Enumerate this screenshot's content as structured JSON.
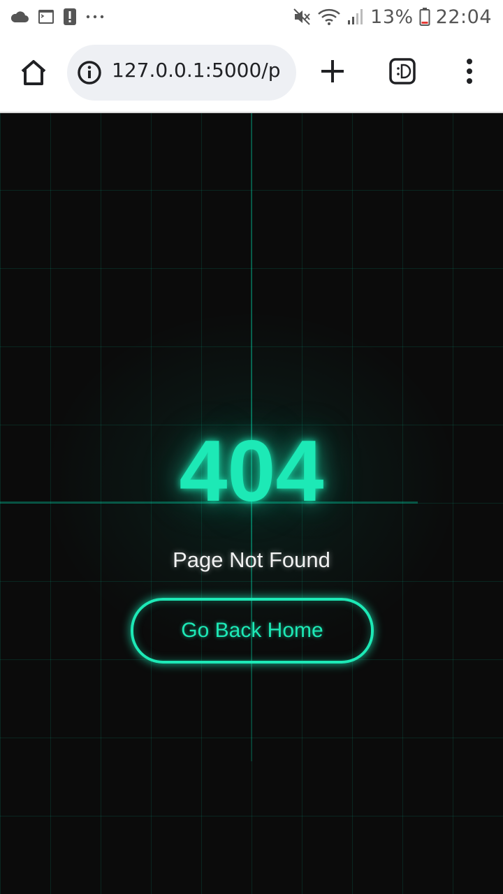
{
  "status_bar": {
    "battery_percent": "13%",
    "time": "22:04",
    "notification_icons": [
      "cloud-icon",
      "terminal-icon",
      "alert-icon",
      "more-notifications-icon"
    ],
    "system_icons": [
      "mute-icon",
      "wifi-icon",
      "signal-icon",
      "battery-icon"
    ]
  },
  "browser": {
    "url": "127.0.0.1:5000/p",
    "buttons": [
      "home-icon",
      "info-icon",
      "new-tab-icon",
      "tab-switcher-icon",
      "menu-icon"
    ]
  },
  "page": {
    "error_code": "404",
    "message": "Page Not Found",
    "home_button_label": "Go Back Home",
    "accent_color": "#1de9b6",
    "background_color": "#0b0b0b"
  }
}
